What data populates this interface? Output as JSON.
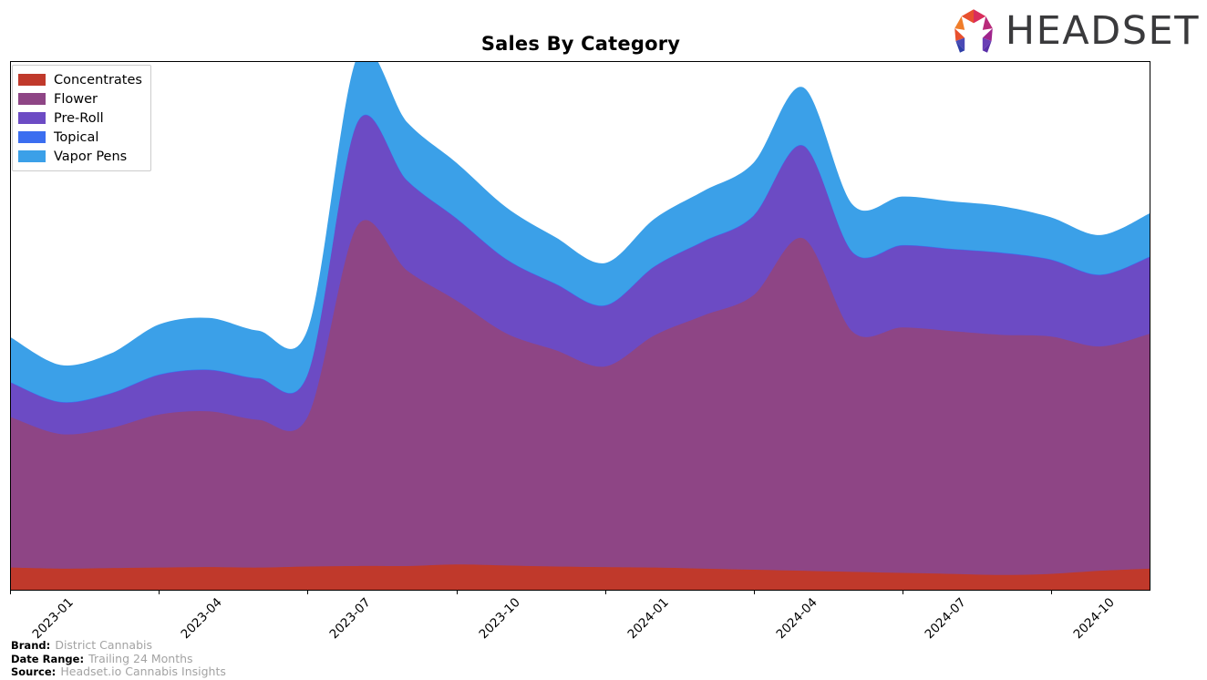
{
  "title": "Sales By Category",
  "brand_logo": {
    "text": "HEADSET",
    "mark_name": "headset-arch-logo"
  },
  "legend": {
    "items": [
      {
        "label": "Concentrates",
        "color": "#c0392b"
      },
      {
        "label": "Flower",
        "color": "#8e4585"
      },
      {
        "label": "Pre-Roll",
        "color": "#6c4bc4"
      },
      {
        "label": "Topical",
        "color": "#3b6ef0"
      },
      {
        "label": "Vapor Pens",
        "color": "#3ba0e8"
      }
    ]
  },
  "footer": {
    "brand_key": "Brand:",
    "brand_value": "District Cannabis",
    "date_range_key": "Date Range:",
    "date_range_value": "Trailing 24 Months",
    "source_key": "Source:",
    "source_value": "Headset.io Cannabis Insights"
  },
  "chart_data": {
    "type": "area",
    "title": "Sales By Category",
    "xlabel": "",
    "ylabel": "",
    "stacked": true,
    "grid": false,
    "legend_position": "upper-left",
    "axis": {
      "y_visible_ticks": false,
      "x_tick_labels": [
        "2023-01",
        "2023-04",
        "2023-07",
        "2023-10",
        "2024-01",
        "2024-04",
        "2024-07",
        "2024-10"
      ],
      "x_tick_index": [
        0,
        3,
        6,
        9,
        12,
        15,
        18,
        21
      ]
    },
    "x": [
      "2023-01",
      "2023-02",
      "2023-03",
      "2023-04",
      "2023-05",
      "2023-06",
      "2023-07",
      "2023-08",
      "2023-09",
      "2023-10",
      "2023-11",
      "2023-12",
      "2024-01",
      "2024-02",
      "2024-03",
      "2024-04",
      "2024-05",
      "2024-06",
      "2024-07",
      "2024-08",
      "2024-09",
      "2024-10",
      "2024-11",
      "2024-12"
    ],
    "ylim": [
      0,
      100
    ],
    "series": [
      {
        "name": "Concentrates",
        "color": "#c0392b",
        "values": [
          4.2,
          4.0,
          4.1,
          4.2,
          4.3,
          4.2,
          4.4,
          4.5,
          4.5,
          4.8,
          4.6,
          4.4,
          4.3,
          4.2,
          4.0,
          3.8,
          3.6,
          3.4,
          3.2,
          3.0,
          2.8,
          3.0,
          3.6,
          4.0
        ]
      },
      {
        "name": "Flower",
        "color": "#8e4585",
        "values": [
          28.5,
          25.5,
          26.5,
          29.0,
          29.5,
          28.0,
          28.5,
          64.5,
          56.0,
          50.0,
          44.0,
          41.0,
          38.0,
          44.0,
          48.0,
          52.0,
          63.0,
          45.5,
          46.5,
          46.0,
          45.5,
          45.0,
          42.5,
          44.5
        ]
      },
      {
        "name": "Pre-Roll",
        "color": "#6c4bc4",
        "values": [
          6.5,
          6.0,
          6.5,
          7.5,
          7.8,
          7.8,
          8.0,
          19.5,
          17.0,
          15.5,
          14.0,
          12.5,
          11.5,
          13.0,
          14.0,
          15.0,
          17.5,
          15.0,
          15.5,
          15.5,
          15.5,
          14.5,
          13.5,
          14.5
        ]
      },
      {
        "name": "Topical",
        "color": "#3b6ef0",
        "values": [
          0.1,
          0.1,
          0.1,
          0.1,
          0.1,
          0.1,
          0.1,
          0.1,
          0.1,
          0.1,
          0.1,
          0.1,
          0.1,
          0.1,
          0.1,
          0.1,
          0.1,
          0.1,
          0.1,
          0.1,
          0.1,
          0.1,
          0.1,
          0.1
        ]
      },
      {
        "name": "Vapor Pens",
        "color": "#3ba0e8",
        "values": [
          8.5,
          7.0,
          7.5,
          9.5,
          9.8,
          9.0,
          8.5,
          12.5,
          11.0,
          10.5,
          9.8,
          8.8,
          8.0,
          9.0,
          9.5,
          10.0,
          11.0,
          9.0,
          9.2,
          9.0,
          8.8,
          8.0,
          7.5,
          8.2
        ]
      }
    ]
  }
}
